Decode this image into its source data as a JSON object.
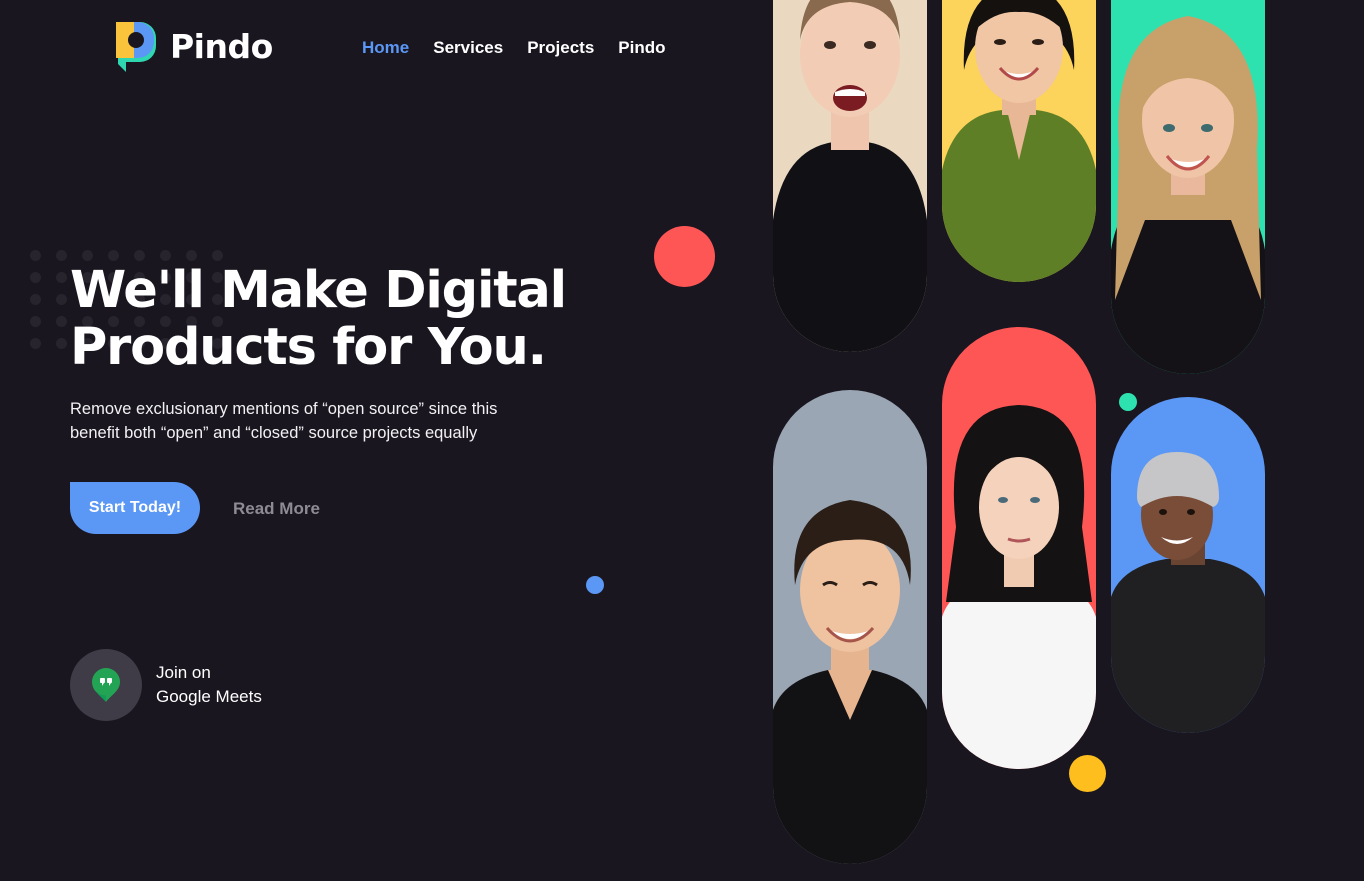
{
  "brand": {
    "name": "Pindo",
    "logo_colors": [
      "#f9c33c",
      "#5b97f5",
      "#2fd7b0"
    ]
  },
  "nav": {
    "items": [
      {
        "label": "Home",
        "active": true
      },
      {
        "label": "Services",
        "active": false
      },
      {
        "label": "Projects",
        "active": false
      },
      {
        "label": "Pindo",
        "active": false
      }
    ]
  },
  "hero": {
    "headline_line1": "We'll Make Digital",
    "headline_line2": "Products for You.",
    "subtext_line1": "Remove exclusionary mentions of “open source” since this",
    "subtext_line2": "benefit both “open” and “closed” source projects equally",
    "primary_button": "Start Today!",
    "secondary_button": "Read More"
  },
  "meet": {
    "line1": "Join on",
    "line2": "Google Meets",
    "icon": "google-meet-icon"
  },
  "colors": {
    "background": "#19161f",
    "accent": "#5b97f5",
    "red": "#fe5555",
    "yellow": "#fdbe1e",
    "teal": "#2ee2b0",
    "gray_pill": "#9aa6b4"
  },
  "gallery": {
    "photos": [
      {
        "name": "woman-excited-photo",
        "background": "#ead9c0"
      },
      {
        "name": "woman-green-shirt-photo",
        "background": "#fcd35b"
      },
      {
        "name": "woman-blonde-photo",
        "background": "#2ee2b0"
      },
      {
        "name": "man-black-shirt-photo",
        "background": "#9aa6b4"
      },
      {
        "name": "woman-dark-hair-photo",
        "background": "#fe5555"
      },
      {
        "name": "man-beanie-photo",
        "background": "#5b97f5"
      }
    ]
  }
}
